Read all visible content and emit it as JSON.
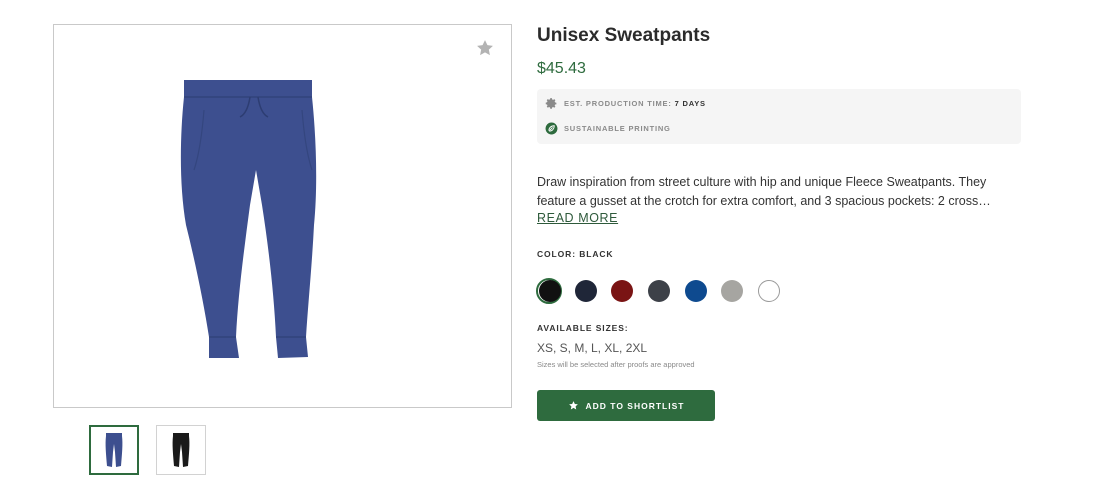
{
  "product": {
    "title": "Unisex Sweatpants",
    "price": "$45.43",
    "main_image_color": "#3d4f8f",
    "favorite_icon": "star-icon"
  },
  "info": {
    "production_label": "EST. PRODUCTION TIME:",
    "production_value": "7 DAYS",
    "production_icon": "gear-icon",
    "sustainable_label": "SUSTAINABLE PRINTING",
    "sustainable_icon": "leaf-icon"
  },
  "description": {
    "text": "Draw inspiration from street culture with hip and unique Fleece Sweatpants. They feature a gusset at the crotch for extra comfort, and 3 spacious pockets: 2 cross…",
    "read_more": "READ MORE"
  },
  "color": {
    "label_prefix": "COLOR:",
    "selected": "BLACK",
    "swatches": [
      {
        "name": "black",
        "hex": "#111111"
      },
      {
        "name": "navy",
        "hex": "#1f2638"
      },
      {
        "name": "maroon",
        "hex": "#7a1414"
      },
      {
        "name": "charcoal",
        "hex": "#3d4148"
      },
      {
        "name": "royal-blue",
        "hex": "#0e4a8f"
      },
      {
        "name": "grey",
        "hex": "#a6a5a1"
      },
      {
        "name": "white",
        "hex": "#ffffff"
      }
    ]
  },
  "sizes": {
    "label": "AVAILABLE SIZES:",
    "value": "XS, S, M, L, XL, 2XL",
    "note": "Sizes will be selected after proofs are approved"
  },
  "thumbnails": [
    {
      "color": "#3d4f8f",
      "selected": true
    },
    {
      "color": "#1a1a1a",
      "selected": false
    }
  ],
  "cta": {
    "label": "ADD TO SHORTLIST",
    "icon": "star-icon",
    "color": "#2e6b3e"
  }
}
